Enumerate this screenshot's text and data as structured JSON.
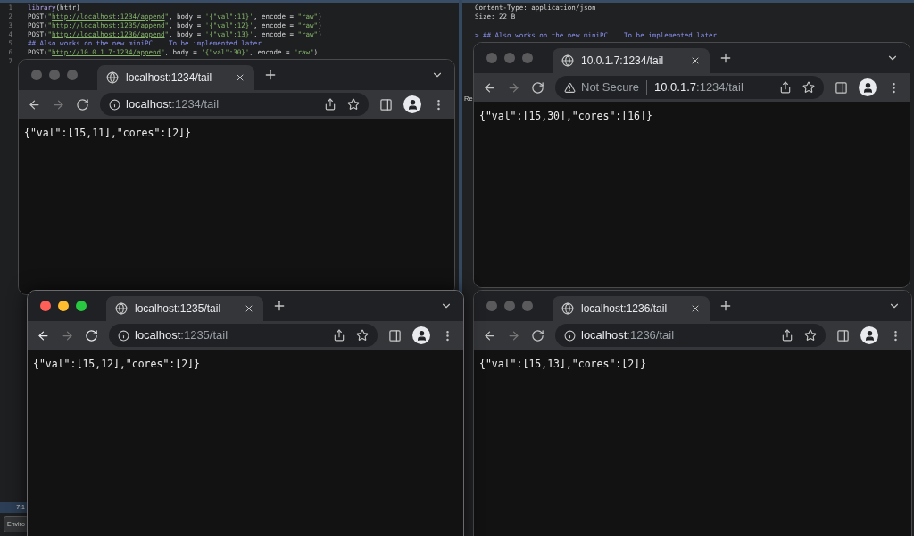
{
  "editor": {
    "lines": [
      {
        "number": "1",
        "tokens": [
          {
            "kind": "fn",
            "text": "library"
          },
          {
            "kind": "plain",
            "text": "(httr)"
          }
        ]
      },
      {
        "number": "2",
        "tokens": [
          {
            "kind": "plain",
            "text": "POST("
          },
          {
            "kind": "string",
            "text": "\""
          },
          {
            "kind": "url",
            "text": "http://localhost:1234/append"
          },
          {
            "kind": "string",
            "text": "\""
          },
          {
            "kind": "plain",
            "text": ", body = "
          },
          {
            "kind": "string",
            "text": "'{\"val\":11}'"
          },
          {
            "kind": "plain",
            "text": ", encode = "
          },
          {
            "kind": "string",
            "text": "\"raw\""
          },
          {
            "kind": "plain",
            "text": ")"
          }
        ]
      },
      {
        "number": "3",
        "tokens": [
          {
            "kind": "plain",
            "text": "POST("
          },
          {
            "kind": "string",
            "text": "\""
          },
          {
            "kind": "url",
            "text": "http://localhost:1235/append"
          },
          {
            "kind": "string",
            "text": "\""
          },
          {
            "kind": "plain",
            "text": ", body = "
          },
          {
            "kind": "string",
            "text": "'{\"val\":12}'"
          },
          {
            "kind": "plain",
            "text": ", encode = "
          },
          {
            "kind": "string",
            "text": "\"raw\""
          },
          {
            "kind": "plain",
            "text": ")"
          }
        ]
      },
      {
        "number": "4",
        "tokens": [
          {
            "kind": "plain",
            "text": "POST("
          },
          {
            "kind": "string",
            "text": "\""
          },
          {
            "kind": "url",
            "text": "http://localhost:1236/append"
          },
          {
            "kind": "string",
            "text": "\""
          },
          {
            "kind": "plain",
            "text": ", body = "
          },
          {
            "kind": "string",
            "text": "'{\"val\":13}'"
          },
          {
            "kind": "plain",
            "text": ", encode = "
          },
          {
            "kind": "string",
            "text": "\"raw\""
          },
          {
            "kind": "plain",
            "text": ")"
          }
        ]
      },
      {
        "number": "5",
        "tokens": [
          {
            "kind": "comment",
            "text": "## Also works on the new miniPC... To be implemented later."
          }
        ]
      },
      {
        "number": "6",
        "tokens": [
          {
            "kind": "plain",
            "text": "POST("
          },
          {
            "kind": "string",
            "text": "\""
          },
          {
            "kind": "url",
            "text": "http://10.0.1.7:1234/append"
          },
          {
            "kind": "string",
            "text": "\""
          },
          {
            "kind": "plain",
            "text": ", body = "
          },
          {
            "kind": "string",
            "text": "'{\"val\":30}'"
          },
          {
            "kind": "plain",
            "text": ", encode = "
          },
          {
            "kind": "string",
            "text": "\"raw\""
          },
          {
            "kind": "plain",
            "text": ")"
          }
        ]
      },
      {
        "number": "7"
      }
    ],
    "position": "7:1",
    "pane_tab": "Enviro"
  },
  "console": {
    "lines": [
      {
        "kind": "output",
        "tokens": [
          {
            "kind": "plain",
            "text": "Content-Type: application/json"
          }
        ]
      },
      {
        "kind": "output",
        "tokens": [
          {
            "kind": "plain",
            "text": "Size: 22 B"
          }
        ]
      },
      {
        "kind": "blank"
      },
      {
        "kind": "input",
        "tokens": [
          {
            "kind": "prompt",
            "text": "> "
          },
          {
            "kind": "comment",
            "text": "## Also works on the new miniPC... To be implemented later."
          }
        ]
      }
    ],
    "cut_label": "Re"
  },
  "browsers": [
    {
      "active": false,
      "tab_title": "localhost:1234/tail",
      "security": {
        "kind": "info"
      },
      "url_host": "localhost",
      "url_path": ":1234/tail",
      "body": "{\"val\":[15,11],\"cores\":[2]}"
    },
    {
      "active": false,
      "tab_title": "10.0.1.7:1234/tail",
      "security": {
        "kind": "warning",
        "label": "Not Secure"
      },
      "url_host": "10.0.1.7",
      "url_path": ":1234/tail",
      "body": "{\"val\":[15,30],\"cores\":[16]}"
    },
    {
      "active": true,
      "tab_title": "localhost:1235/tail",
      "security": {
        "kind": "info"
      },
      "url_host": "localhost",
      "url_path": ":1235/tail",
      "body": "{\"val\":[15,12],\"cores\":[2]}"
    },
    {
      "active": false,
      "tab_title": "localhost:1236/tail",
      "security": {
        "kind": "info"
      },
      "url_host": "localhost",
      "url_path": ":1236/tail",
      "body": "{\"val\":[15,13],\"cores\":[2]}"
    }
  ]
}
